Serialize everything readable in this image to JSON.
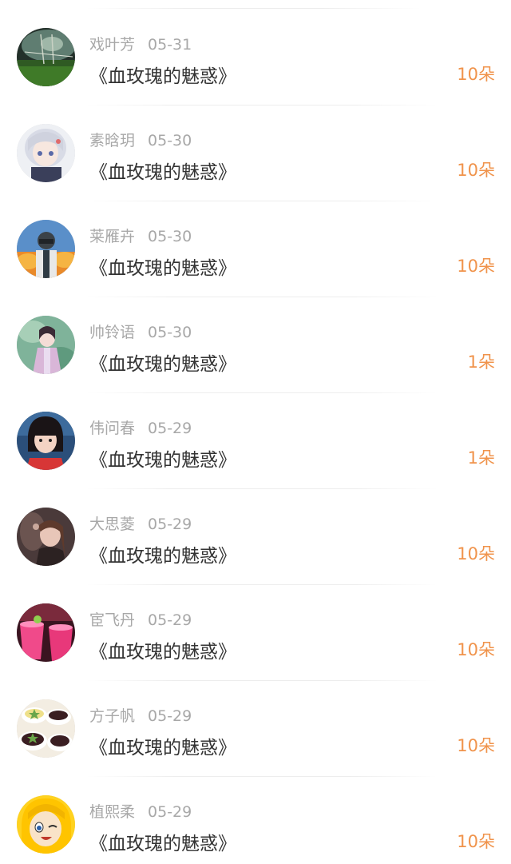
{
  "items": [
    {
      "name": "戏叶芳",
      "date": "05-31",
      "title": "《血玫瑰的魅惑》",
      "amount": "10朵",
      "avatar_icon": "field-scene-avatar"
    },
    {
      "name": "素晗玥",
      "date": "05-30",
      "title": "《血玫瑰的魅惑》",
      "amount": "10朵",
      "avatar_icon": "anime-girl-avatar"
    },
    {
      "name": "莱雁卉",
      "date": "05-30",
      "title": "《血玫瑰的魅惑》",
      "amount": "10朵",
      "avatar_icon": "game-soldier-avatar"
    },
    {
      "name": "帅铃语",
      "date": "05-30",
      "title": "《血玫瑰的魅惑》",
      "amount": "1朵",
      "avatar_icon": "costume-girl-avatar"
    },
    {
      "name": "伟问春",
      "date": "05-29",
      "title": "《血玫瑰的魅惑》",
      "amount": "1朵",
      "avatar_icon": "child-photo-avatar"
    },
    {
      "name": "大思菱",
      "date": "05-29",
      "title": "《血玫瑰的魅惑》",
      "amount": "10朵",
      "avatar_icon": "woman-portrait-avatar"
    },
    {
      "name": "宦飞丹",
      "date": "05-29",
      "title": "《血玫瑰的魅惑》",
      "amount": "10朵",
      "avatar_icon": "pink-drinks-avatar"
    },
    {
      "name": "方子帆",
      "date": "05-29",
      "title": "《血玫瑰的魅惑》",
      "amount": "10朵",
      "avatar_icon": "dessert-cups-avatar"
    },
    {
      "name": "植熙柔",
      "date": "05-29",
      "title": "《血玫瑰的魅惑》",
      "amount": "10朵",
      "avatar_icon": "cartoon-blonde-avatar"
    }
  ],
  "colors": {
    "amount": "#f0934b",
    "meta": "#a8a8a8",
    "title": "#333333"
  }
}
